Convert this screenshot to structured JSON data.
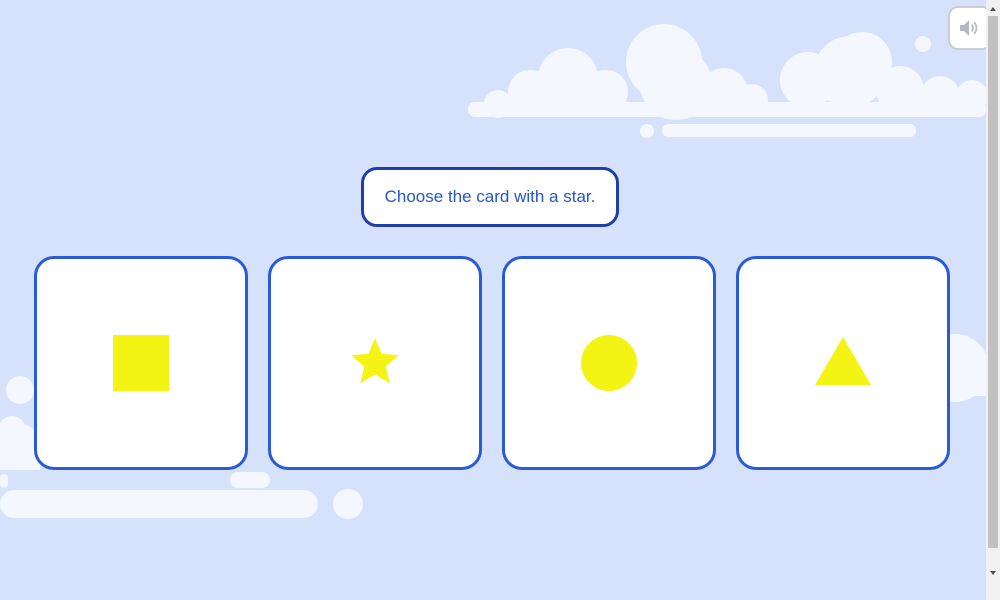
{
  "prompt": {
    "text": "Choose the card with a star."
  },
  "cards": [
    {
      "shape": "square",
      "color": "#f4f414"
    },
    {
      "shape": "star",
      "color": "#f4f414"
    },
    {
      "shape": "circle",
      "color": "#f4f414"
    },
    {
      "shape": "triangle",
      "color": "#f4f414"
    }
  ],
  "sound_button": {
    "icon": "speaker-icon"
  },
  "colors": {
    "background": "#d6e2fb",
    "card_border": "#2a5bd7",
    "prompt_border": "#1e3fa5",
    "prompt_text": "#2456c8",
    "shape_fill": "#f4f414",
    "cloud": "#f4f7fe"
  }
}
